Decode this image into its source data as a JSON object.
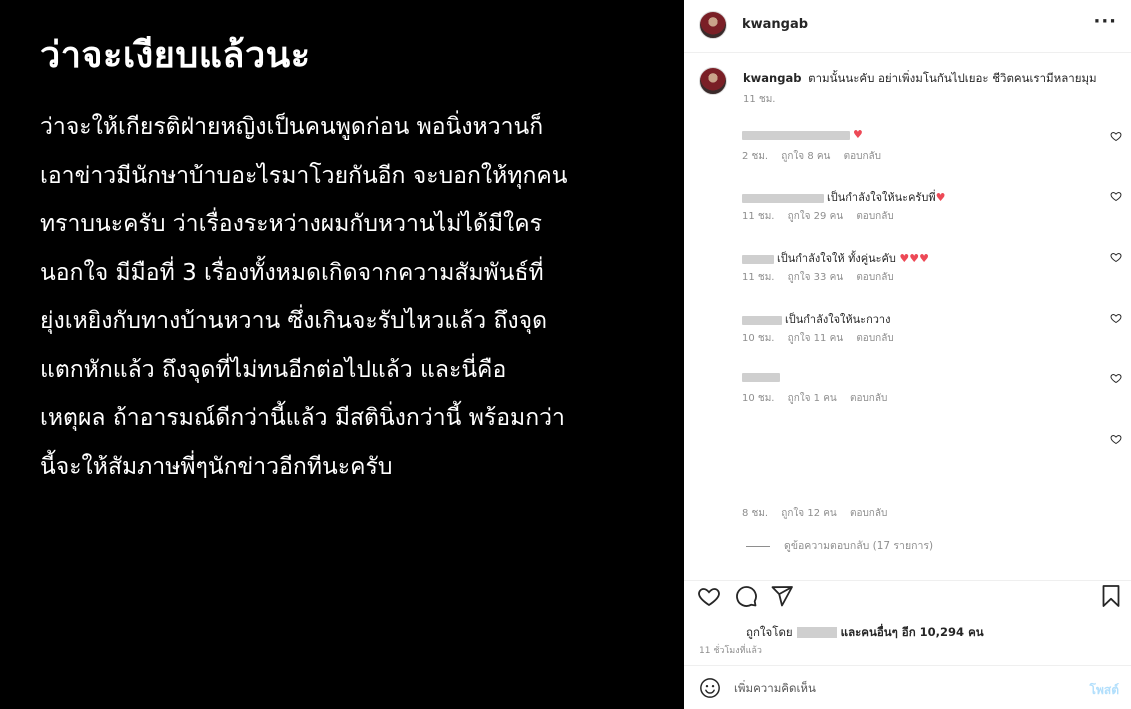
{
  "post": {
    "title": "ว่าจะเงียบแล้วนะ",
    "body_lines": [
      "ว่าจะให้เกียรติฝ่ายหญิงเป็นคนพูดก่อน พอนิ่งหวานก็",
      "เอาข่าวมีนักษาบ้าบอะไรมาโวยกันอีก จะบอกให้ทุกคน",
      "ทราบนะครับ ว่าเรื่องระหว่างผมกับหวานไม่ได้มีใคร",
      "นอกใจ มีมือที่ 3 เรื่องทั้งหมดเกิดจากความสัมพันธ์ที่",
      "ยุ่งเหยิงกับทางบ้านหวาน ซึ่งเกินจะรับไหวแล้ว ถึงจุด",
      "แตกหักแล้ว ถึงจุดที่ไม่ทนอีกต่อไปแล้ว และนี่คือ",
      "เหตุผล ถ้าอารมณ์ดีกว่านี้แล้ว มีสตินิ่งกว่านี้ พร้อมกว่า",
      "นี้จะให้สัมภาษพี่ๆนักข่าวอีกทีนะครับ"
    ]
  },
  "header": {
    "username": "kwangab",
    "more_icon": "more-horizontal-icon"
  },
  "caption": {
    "username": "kwangab",
    "text": "ตามนั้นนะคับ อย่าเพิ่งมโนกันไปเยอะ ชีวิตคนเรามีหลายมุม",
    "time": "11 ชม."
  },
  "replies": [
    {
      "visible_text": "",
      "hearts": "♥",
      "time": "2 ชม.",
      "likes": "ถูกใจ 8 คน",
      "reply": "ตอบกลับ"
    },
    {
      "visible_text": "เป็นกำลังใจให้นะครับพี่",
      "hearts": "♥",
      "time": "11 ชม.",
      "likes": "ถูกใจ 29 คน",
      "reply": "ตอบกลับ"
    },
    {
      "visible_text": "เป็นกำลังใจให้ ทั้งคู่นะคับ",
      "hearts": "♥♥♥",
      "time": "11 ชม.",
      "likes": "ถูกใจ 33 คน",
      "reply": "ตอบกลับ"
    },
    {
      "visible_text": "เป็นกำลังใจให้นะกวาง",
      "hearts": "",
      "time": "10 ชม.",
      "likes": "ถูกใจ 11 คน",
      "reply": "ตอบกลับ"
    },
    {
      "visible_text": "",
      "hearts": "",
      "time": "10 ชม.",
      "likes": "ถูกใจ 1 คน",
      "reply": "ตอบกลับ"
    },
    {
      "visible_text": "",
      "hearts": "",
      "time": "8 ชม.",
      "likes": "ถูกใจ 12 คน",
      "reply": "ตอบกลับ"
    }
  ],
  "view_replies": "ดูข้อความตอบกลับ (17 รายการ)",
  "likes": {
    "prefix": "ถูกใจโดย",
    "suffix": "และคนอื่นๆ อีก 10,294 คน"
  },
  "post_time": "11 ชั่วโมงที่แล้ว",
  "composer": {
    "placeholder": "เพิ่มความคิดเห็น",
    "post_label": "โพสต์"
  },
  "colors": {
    "heart_red": "#ed4956",
    "muted": "#8e8e8e",
    "post_button": "#b2dffc"
  }
}
